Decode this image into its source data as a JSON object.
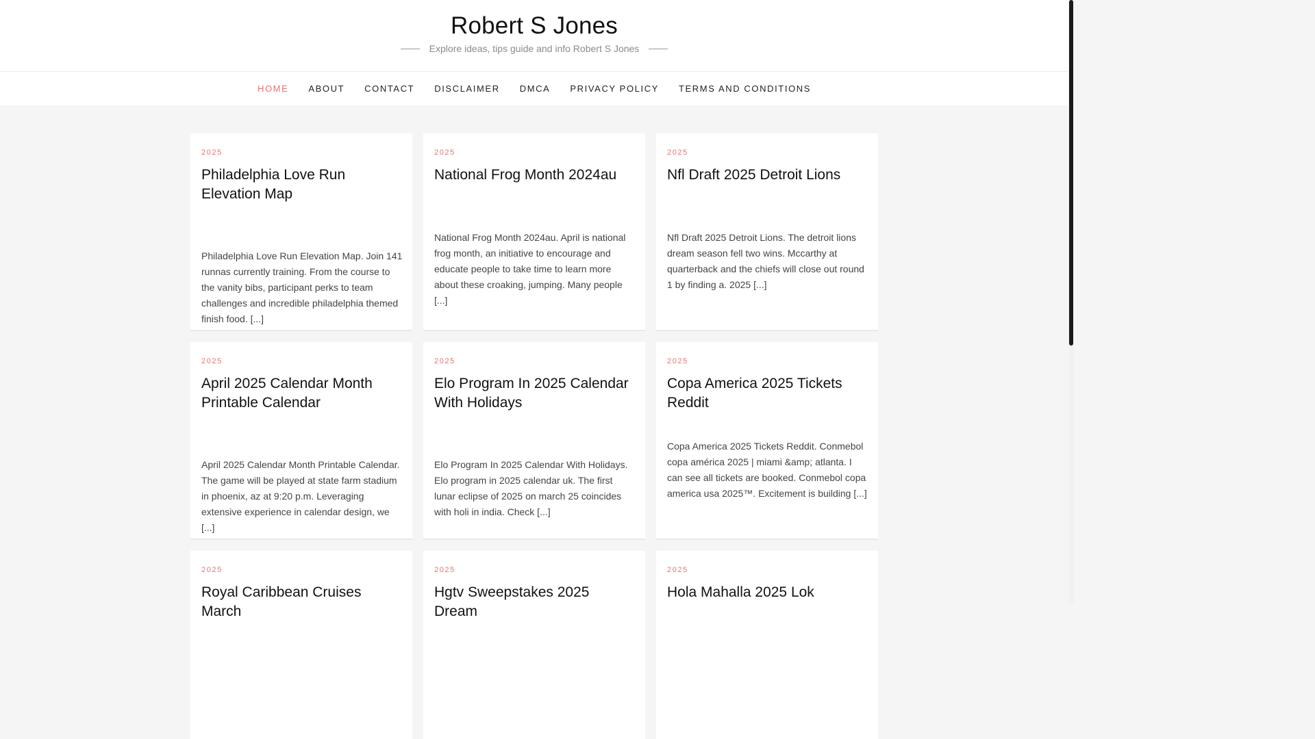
{
  "site": {
    "title": "Robert S Jones",
    "tagline": "Explore ideas, tips guide and info Robert S Jones"
  },
  "nav": {
    "items": [
      {
        "label": "HOME",
        "active": true
      },
      {
        "label": "ABOUT"
      },
      {
        "label": "CONTACT"
      },
      {
        "label": "DISCLAIMER"
      },
      {
        "label": "DMCA"
      },
      {
        "label": "PRIVACY POLICY"
      },
      {
        "label": "TERMS AND CONDITIONS"
      }
    ]
  },
  "posts": [
    {
      "category": "2025",
      "title": "Philadelphia Love Run Elevation Map",
      "excerpt": "Philadelphia Love Run Elevation Map. Join 141 runnas currently training. From the course to the vanity bibs, participant perks to team challenges and incredible philadelphia themed finish food. [...]"
    },
    {
      "category": "2025",
      "title": "National Frog Month 2024au",
      "excerpt": "National Frog Month 2024au. April is national frog month, an initiative to encourage and educate people to take time to learn more about these croaking, jumping. Many people [...]"
    },
    {
      "category": "2025",
      "title": "Nfl Draft 2025 Detroit Lions",
      "excerpt": "Nfl Draft 2025 Detroit Lions. The detroit lions dream season fell two wins. Mccarthy at quarterback and the chiefs will close out round 1 by finding a. 2025 [...]"
    },
    {
      "category": "2025",
      "title": "April 2025 Calendar Month Printable Calendar",
      "excerpt": "April 2025 Calendar Month Printable Calendar. The game will be played at state farm stadium in phoenix, az at 9:20 p.m. Leveraging extensive experience in calendar design, we [...]"
    },
    {
      "category": "2025",
      "title": "Elo Program In 2025 Calendar With Holidays",
      "excerpt": "Elo Program In 2025 Calendar With Holidays. Elo program in 2025 calendar uk. The first lunar eclipse of 2025 on march 25 coincides with holi in india. Check [...]"
    },
    {
      "category": "2025",
      "title": "Copa America 2025 Tickets Reddit",
      "excerpt": "Copa America 2025 Tickets Reddit. Conmebol copa américa 2025 | miami &amp; atlanta. I can see all tickets are booked. Conmebol copa america usa 2025™. Excitement is building [...]"
    },
    {
      "category": "2025",
      "title": "Royal Caribbean Cruises March",
      "excerpt": ""
    },
    {
      "category": "2025",
      "title": "Hgtv Sweepstakes 2025 Dream",
      "excerpt": ""
    },
    {
      "category": "2025",
      "title": "Hola Mahalla 2025 Lok",
      "excerpt": ""
    }
  ]
}
